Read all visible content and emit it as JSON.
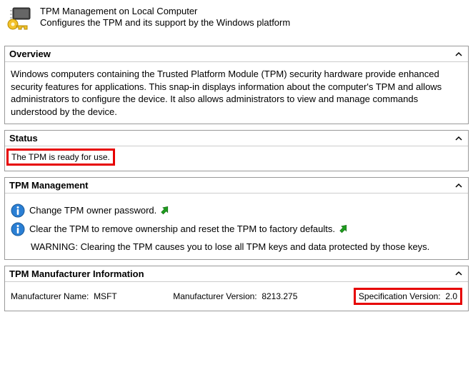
{
  "header": {
    "title": "TPM Management on Local Computer",
    "subtitle": "Configures the TPM and its support by the Windows platform"
  },
  "overview": {
    "title": "Overview",
    "text": "Windows computers containing the Trusted Platform Module (TPM) security hardware provide enhanced security features for applications. This snap-in displays information about the computer's TPM and allows administrators to configure the device. It also allows administrators to view and manage commands understood by the device."
  },
  "status": {
    "title": "Status",
    "text": "The TPM is ready for use."
  },
  "management": {
    "title": "TPM Management",
    "change_pw": "Change TPM owner password.",
    "clear": "Clear the TPM to remove ownership and reset the TPM to factory defaults.",
    "warning": "WARNING: Clearing the TPM causes you to lose all TPM keys and data protected by those keys."
  },
  "manufacturer": {
    "title": "TPM Manufacturer Information",
    "name_label": "Manufacturer Name:",
    "name_value": "MSFT",
    "version_label": "Manufacturer Version:",
    "version_value": "8213.275",
    "spec_label": "Specification Version:",
    "spec_value": "2.0"
  }
}
